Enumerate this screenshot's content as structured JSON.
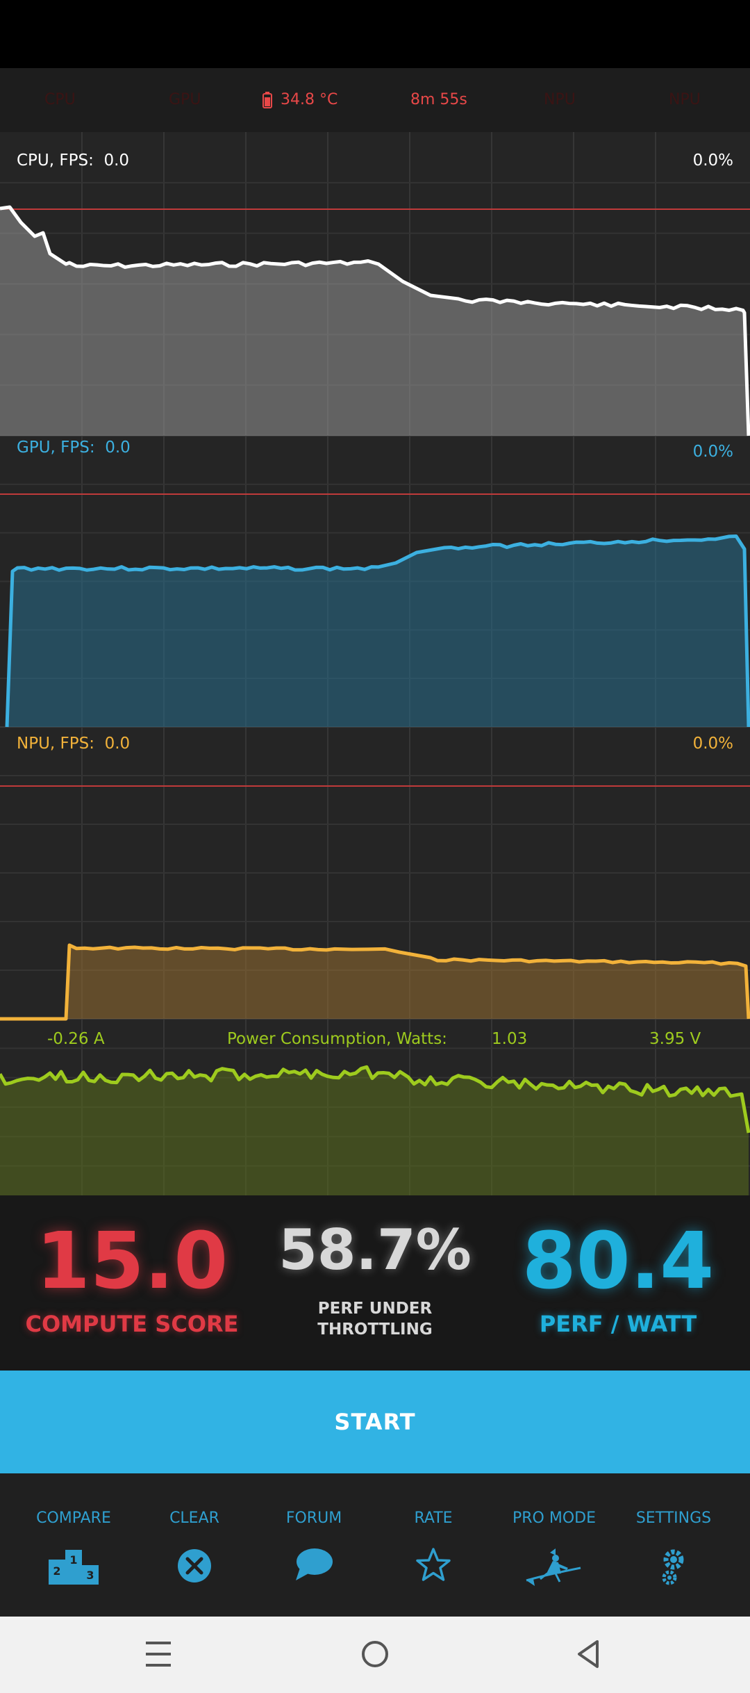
{
  "top_strip": {
    "cpu_label": "CPU",
    "gpu_label": "GPU",
    "battery_temp": "34.8 °C",
    "elapsed": "8m 55s",
    "npu_label_1": "NPU",
    "npu_label_2": "NPU"
  },
  "graphs": {
    "cpu": {
      "label": "CPU, FPS:",
      "fps": "0.0",
      "percent": "0.0%",
      "color": "#ffffff"
    },
    "gpu": {
      "label": "GPU, FPS:",
      "fps": "0.0",
      "percent": "0.0%",
      "color": "#3cb0e0"
    },
    "npu": {
      "label": "NPU, FPS:",
      "fps": "0.0",
      "percent": "0.0%",
      "color": "#f2b23a"
    },
    "power": {
      "current": "-0.26 A",
      "label": "Power Consumption, Watts:",
      "watts": "1.03",
      "voltage": "3.95 V",
      "color": "#9ecb1e"
    }
  },
  "scores": {
    "compute_value": "15.0",
    "compute_label": "COMPUTE SCORE",
    "throttle_value": "58.7%",
    "throttle_label_1": "PERF UNDER",
    "throttle_label_2": "THROTTLING",
    "perf_watt_value": "80.4",
    "perf_watt_label": "PERF / WATT"
  },
  "start_label": "START",
  "nav": [
    {
      "label": "COMPARE",
      "icon": "podium-icon"
    },
    {
      "label": "CLEAR",
      "icon": "clear-icon"
    },
    {
      "label": "FORUM",
      "icon": "chat-bubble-icon"
    },
    {
      "label": "RATE",
      "icon": "star-icon"
    },
    {
      "label": "PRO MODE",
      "icon": "witch-icon"
    },
    {
      "label": "SETTINGS",
      "icon": "gears-icon"
    }
  ],
  "system_nav": {
    "recents": "recents-icon",
    "home": "home-icon",
    "back": "back-icon"
  }
}
